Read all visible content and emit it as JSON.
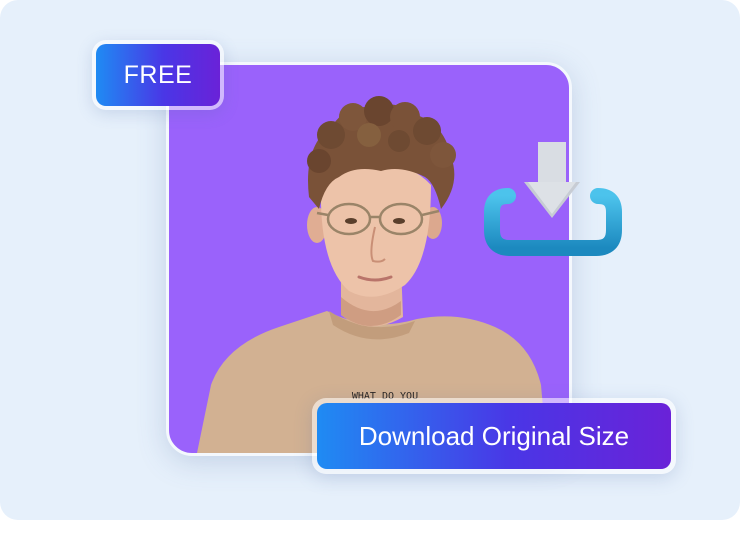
{
  "badge": {
    "label": "FREE"
  },
  "photo": {
    "background_color": "#9a62fb",
    "shirt_text": "WHAT DO YOU"
  },
  "download_button": {
    "label": "Download Original Size"
  },
  "icons": {
    "download": "download-icon"
  },
  "colors": {
    "panel_bg": "#e6f0fb",
    "gradient_start": "#1f8bf3",
    "gradient_mid": "#4a36e6",
    "gradient_end": "#6a22d8",
    "icon_tray": "#2aa6d6",
    "icon_arrow": "#d9dde3"
  }
}
